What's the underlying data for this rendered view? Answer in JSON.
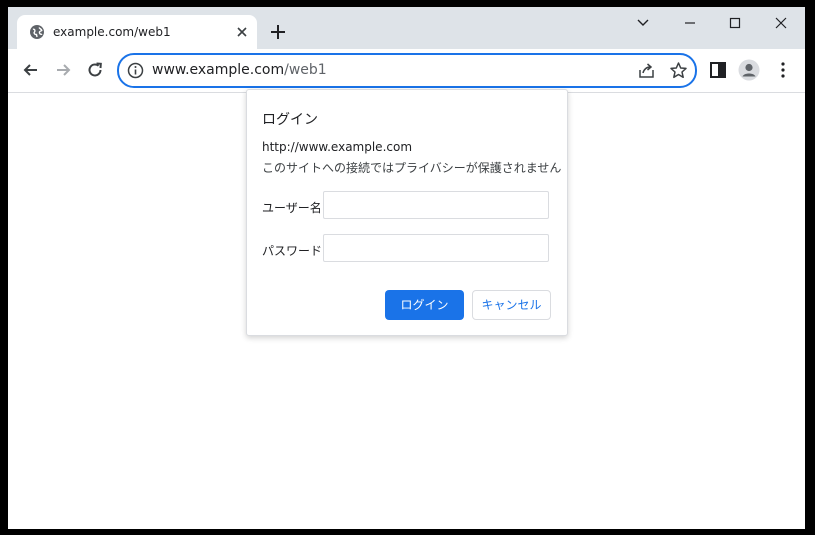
{
  "tab": {
    "title": "example.com/web1",
    "favicon": "globe-icon",
    "close_icon": "close-icon"
  },
  "tabstrip": {
    "new_tab_icon": "plus-icon",
    "controls": [
      "chevron-down-icon",
      "minimize-icon",
      "maximize-icon",
      "close-icon"
    ]
  },
  "toolbar": {
    "back_icon": "back-arrow-icon",
    "forward_icon": "forward-arrow-icon",
    "reload_icon": "reload-icon",
    "side_panel_icon": "side-panel-icon",
    "profile_icon": "profile-avatar-icon",
    "menu_icon": "kebab-menu-icon"
  },
  "omnibox": {
    "host": "www.example.com",
    "path": "/web1",
    "info_icon": "info-icon",
    "share_icon": "share-icon",
    "star_icon": "star-icon"
  },
  "dialog": {
    "title": "ログイン",
    "origin": "http://www.example.com",
    "warning": "このサイトへの接続ではプライバシーが保護されません",
    "username_label": "ユーザー名",
    "username_value": "",
    "password_label": "パスワード",
    "password_value": "",
    "login_button": "ログイン",
    "cancel_button": "キャンセル"
  },
  "colors": {
    "accent": "#1a73e8",
    "tabstrip_bg": "#dee3e8",
    "frame": "#000000"
  }
}
